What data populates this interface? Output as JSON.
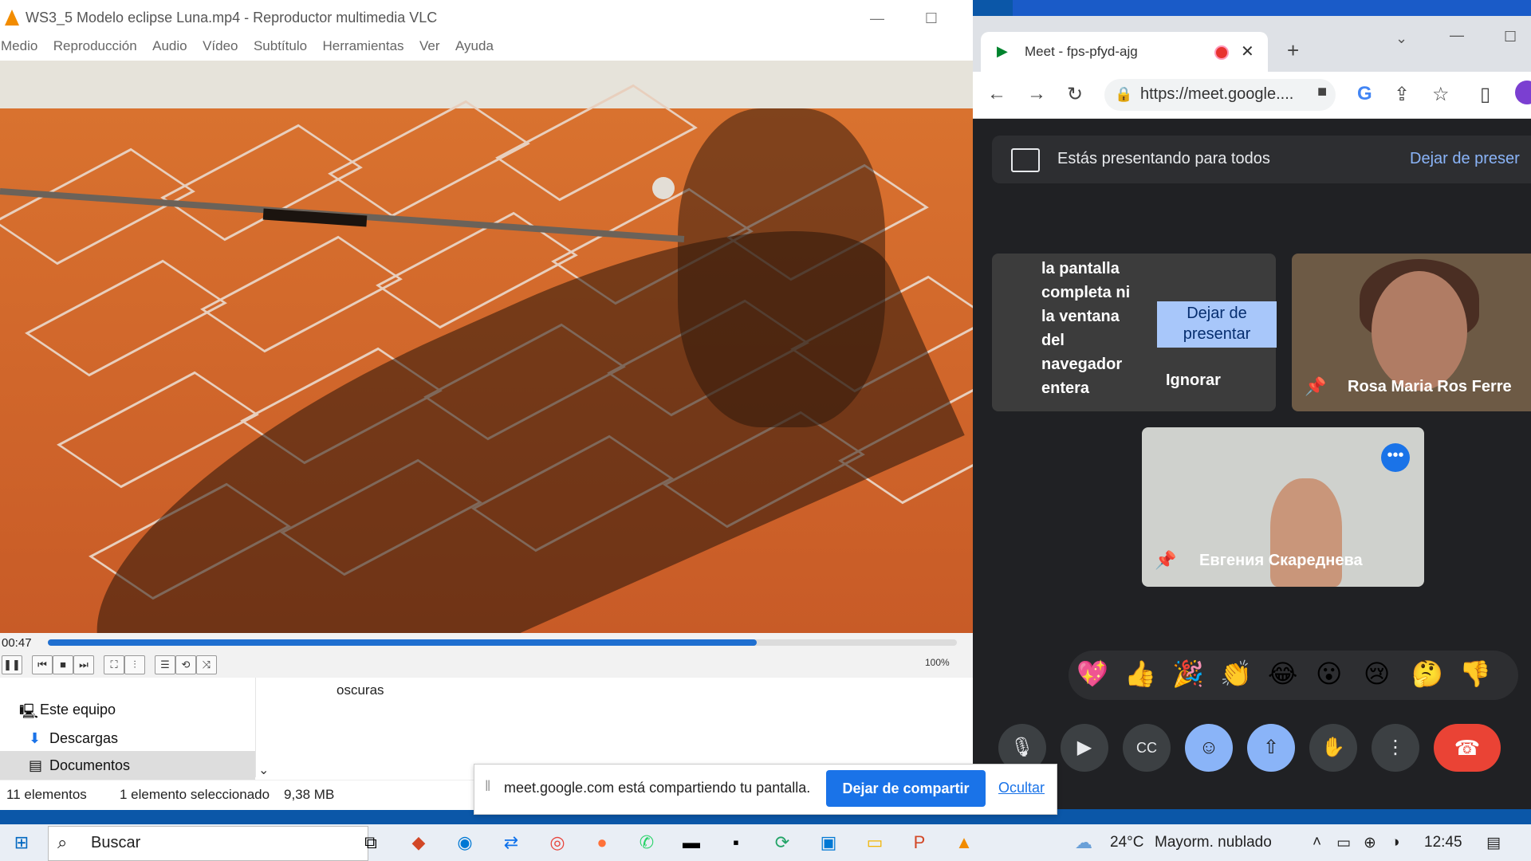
{
  "vlc": {
    "title": "WS3_5 Modelo eclipse Luna.mp4 - Reproductor multimedia VLC",
    "menu": [
      "Medio",
      "Reproducción",
      "Audio",
      "Vídeo",
      "Subtítulo",
      "Herramientas",
      "Ver",
      "Ayuda"
    ],
    "time": "00:47",
    "progress": 0.78,
    "volume": "100%"
  },
  "explorer": {
    "nav": [
      "Este equipo",
      "Descargas",
      "Documentos"
    ],
    "content_text": "oscuras",
    "status_items": "11 elementos",
    "status_selected": "1 elemento seleccionado",
    "status_size": "9,38 MB"
  },
  "chrome": {
    "tab_title": "Meet - fps-pfyd-ajg",
    "url": "https://meet.google....",
    "accent": "#1a73e8"
  },
  "meet": {
    "presenting_text": "Estás presentando para todos",
    "stop_link": "Dejar de preser",
    "tile1_text": "la pantalla completa ni la ventana del navegador entera",
    "tile1_button": "Dejar de presentar",
    "tile1_ignore": "Ignorar",
    "participant1": "Rosa Maria Ros Ferre",
    "participant2": "Евгения Скареднева",
    "emojis": [
      "💖",
      "👍",
      "🎉",
      "👏",
      "😂",
      "😮",
      "😢",
      "🤔",
      "👎"
    ]
  },
  "share_notice": {
    "text": "meet.google.com está compartiendo tu pantalla.",
    "stop_button": "Dejar de compartir",
    "hide_link": "Ocultar"
  },
  "taskbar": {
    "search_placeholder": "Buscar",
    "weather": "24°C",
    "weather_desc": "Mayorm. nublado",
    "clock": "12:45"
  }
}
